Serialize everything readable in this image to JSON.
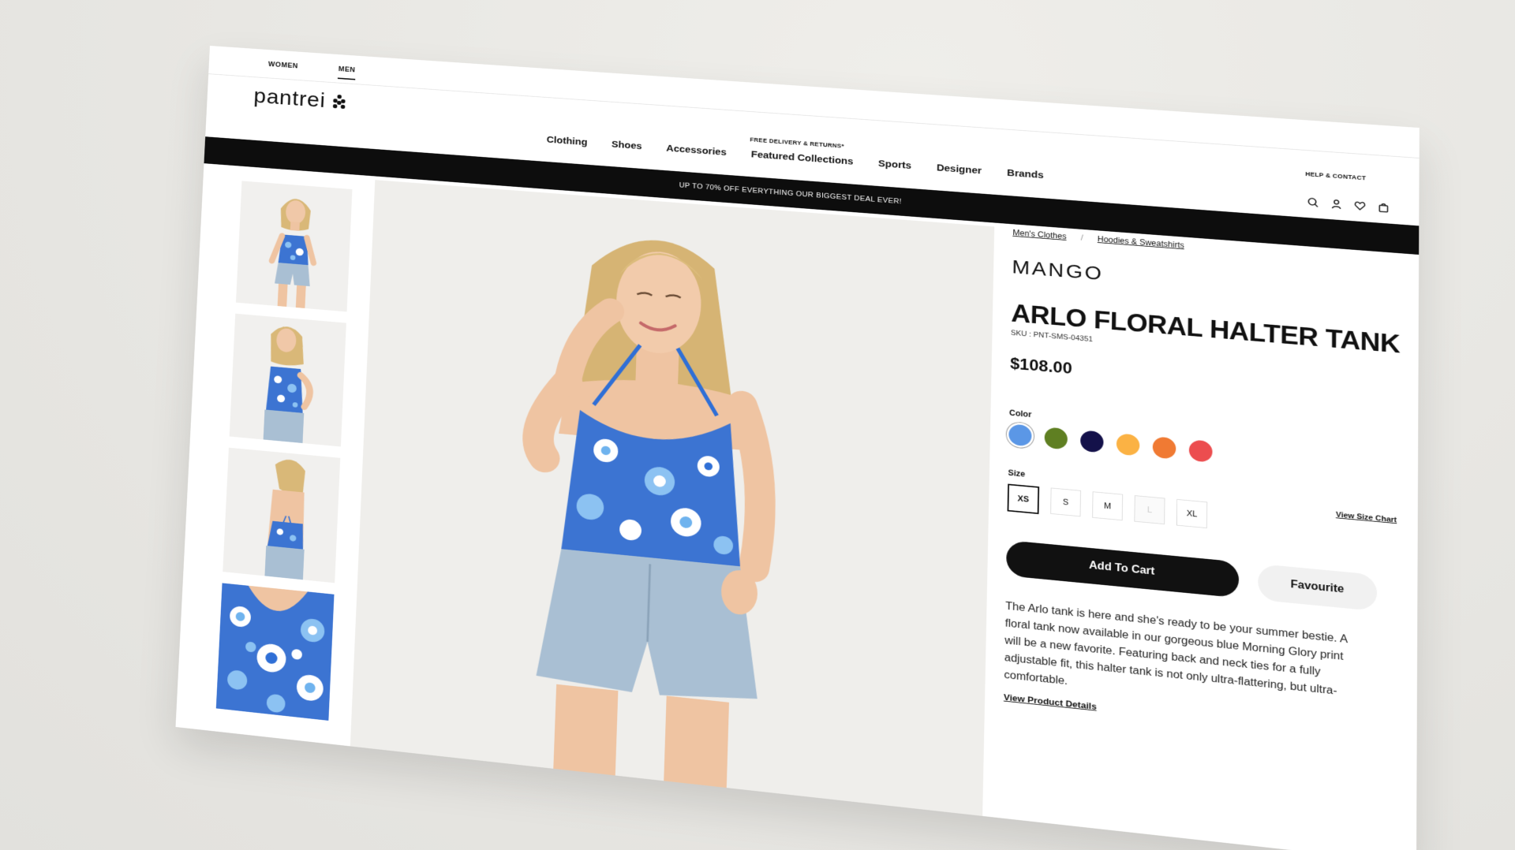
{
  "header": {
    "top_tabs": [
      "WOMEN",
      "MEN"
    ],
    "active_tab": "MEN",
    "logo_text": "pantrei",
    "free_delivery": "FREE DELIVERY & RETURNS*",
    "help_contact": "HELP & CONTACT",
    "nav": [
      "Clothing",
      "Shoes",
      "Accessories",
      "Featured Collections",
      "Sports",
      "Designer",
      "Brands"
    ],
    "icons": [
      "search-icon",
      "user-icon",
      "heart-icon",
      "bag-icon"
    ],
    "promo": "UP TO 70% OFF EVERYTHING OUR BIGGEST DEAL EVER!"
  },
  "gallery": {
    "thumbnails": [
      "front-view",
      "side-view",
      "back-view",
      "fabric-closeup"
    ],
    "print_colors": [
      "#2f6fd6",
      "#6fb3ee",
      "#ffffff",
      "#1f4fa8"
    ],
    "denim_color": "#a9bfd3",
    "background": "#efeeeb"
  },
  "product": {
    "breadcrumb": [
      "Men's Clothes",
      "Hoodies & Sweatshirts"
    ],
    "breadcrumb_separator": "/",
    "brand": "MANGO",
    "title": "ARLO FLORAL HALTER TANK",
    "sku": "SKU : PNT-SMS-04351",
    "price": "$108.00",
    "color_label": "Color",
    "colors": [
      "#5b97e6",
      "#5f7f22",
      "#14114a",
      "#fbb244",
      "#f07a33",
      "#ec4d4f"
    ],
    "selected_color_index": 0,
    "size_label": "Size",
    "sizes": [
      "XS",
      "S",
      "M",
      "L",
      "XL"
    ],
    "selected_size": "XS",
    "disabled_sizes": [
      "L"
    ],
    "size_chart_label": "View Size Chart",
    "add_to_cart": "Add To Cart",
    "favourite": "Favourite",
    "description": "The Arlo tank is here and she's ready to be your summer bestie. A floral tank now available in our gorgeous blue Morning Glory print will be a new favorite. Featuring back and neck ties for a fully adjustable fit, this halter tank is not only ultra-flattering, but ultra-comfortable.",
    "details_link": "View Product Details"
  }
}
